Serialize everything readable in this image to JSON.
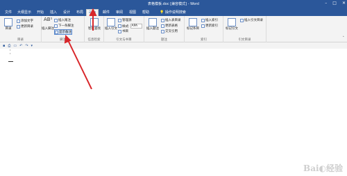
{
  "window": {
    "title": "表格模板.doc [兼容模式] - Word"
  },
  "tabs": [
    {
      "label": "文件"
    },
    {
      "label": "大纲显示"
    },
    {
      "label": "开始"
    },
    {
      "label": "插入"
    },
    {
      "label": "设计"
    },
    {
      "label": "布局"
    },
    {
      "label": "引用"
    },
    {
      "label": "邮件"
    },
    {
      "label": "审阅"
    },
    {
      "label": "视图"
    },
    {
      "label": "帮助"
    }
  ],
  "search": {
    "hint": "操作说明搜索"
  },
  "ribbon": {
    "toc": {
      "big": "目录",
      "add_text": "添加文字",
      "update": "更新目录",
      "group": "目录"
    },
    "footnotes": {
      "insert_footnote": "插入脚注",
      "insert_endnote": "插入尾注",
      "next_footnote": "下一条脚注",
      "show_notes": "显示备注",
      "group": "脚注"
    },
    "research": {
      "smart_lookup": "智能查找",
      "group": "信息检索"
    },
    "citations": {
      "insert_citation": "插入引文",
      "manage_sources": "管理源",
      "style_label": "样式:",
      "style_value": "APA",
      "bibliography": "书目",
      "group": "引文与书目"
    },
    "captions": {
      "insert_caption": "插入题注",
      "insert_table_of_figures": "插入表目录",
      "update_table": "更新表格",
      "cross_reference": "交叉引用",
      "group": "题注"
    },
    "index": {
      "mark_entry": "标记条目",
      "insert_index": "插入索引",
      "update_index": "更新索引",
      "group": "索引"
    },
    "authorities": {
      "mark_citation": "标记引文",
      "insert_toa": "插入引文目录",
      "group": "引文目录"
    }
  },
  "document": {
    "marks": "ᵗ\nᵗ"
  },
  "watermark": {
    "text": "Baidu经验"
  }
}
